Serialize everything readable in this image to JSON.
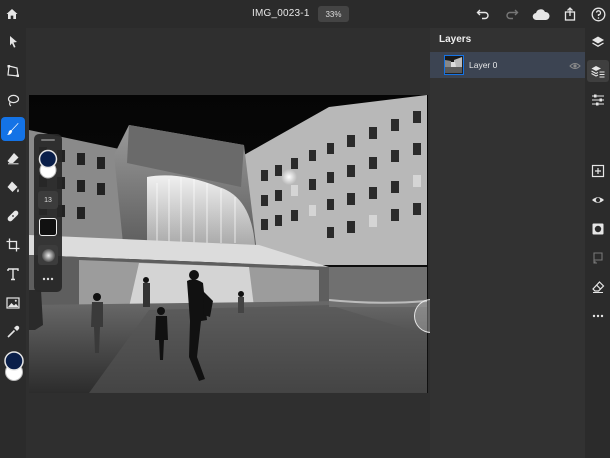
{
  "document": {
    "title": "IMG_0023-1",
    "zoom": "33%"
  },
  "brush_panel": {
    "size": "13"
  },
  "layers": {
    "title": "Layers",
    "items": [
      {
        "name": "Layer 0"
      }
    ]
  },
  "colors": {
    "accent": "#1473e6",
    "foreground": "#0a1f4a",
    "background": "#ffffff"
  }
}
